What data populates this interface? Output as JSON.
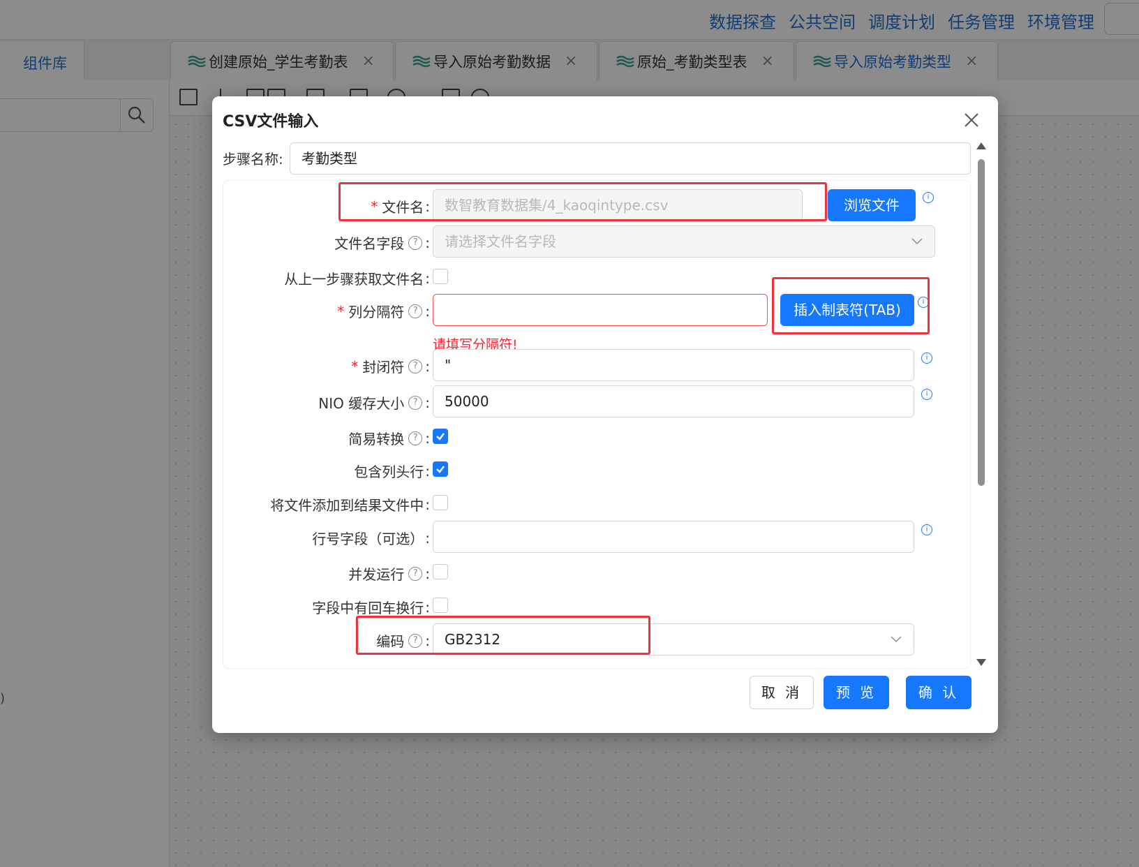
{
  "app": {
    "top_nav": [
      "数据探查",
      "公共空间",
      "调度计划",
      "任务管理",
      "环境管理"
    ],
    "library_tab": "组件库",
    "doc_tabs": [
      {
        "label": "创建原始_学生考勤表",
        "close": "×"
      },
      {
        "label": "导入原始考勤数据",
        "close": "×"
      },
      {
        "label": "原始_考勤类型表",
        "close": "×"
      },
      {
        "label": "导入原始考勤类型",
        "close": "×"
      }
    ],
    "left_stray_text": ")"
  },
  "dialog": {
    "title": "CSV文件输入",
    "step_name_label": "步骤名称:",
    "step_name_value": "考勤类型",
    "fields": {
      "filename": {
        "label": "文件名",
        "value": "数智教育数据集/4_kaoqintype.csv",
        "button": "浏览文件"
      },
      "filename_field": {
        "label": "文件名字段",
        "placeholder": "请选择文件名字段"
      },
      "from_prev": {
        "label": "从上一步骤获取文件名",
        "checked": false
      },
      "delimiter": {
        "label": "列分隔符",
        "value": "",
        "button": "插入制表符(TAB)",
        "error": "请填写分隔符!"
      },
      "enclosure": {
        "label": "封闭符",
        "value": "\""
      },
      "nio_buffer": {
        "label": "NIO 缓存大小",
        "value": "50000"
      },
      "lazy_conversion": {
        "label": "简易转换",
        "checked": true
      },
      "header_row": {
        "label": "包含列头行",
        "checked": true
      },
      "add_to_result": {
        "label": "将文件添加到结果文件中",
        "checked": false
      },
      "row_number_field": {
        "label": "行号字段（可选）",
        "value": ""
      },
      "parallel": {
        "label": "并发运行",
        "checked": false
      },
      "newline_in_field": {
        "label": "字段中有回车换行",
        "checked": false
      },
      "encoding": {
        "label": "编码",
        "value": "GB2312"
      }
    },
    "footer": {
      "cancel": "取 消",
      "preview": "预 览",
      "confirm": "确 认"
    }
  },
  "colors": {
    "primary": "#1677ff",
    "highlight": "#f0323a",
    "error": "#f5222d",
    "nav_text": "#1f6fd6"
  },
  "icons": [
    "search-icon",
    "close-icon",
    "chevron-down-icon",
    "help-icon",
    "info-icon",
    "check-icon",
    "layers-icon"
  ]
}
